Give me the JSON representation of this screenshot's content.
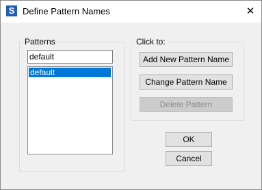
{
  "window": {
    "title": "Define Pattern Names",
    "app_icon_letter": "S",
    "close_symbol": "✕"
  },
  "patterns_group": {
    "label": "Patterns",
    "name_input_value": "default",
    "list_items": [
      "default"
    ],
    "selected_index": 0
  },
  "click_group": {
    "label": "Click to:",
    "add_label": "Add New Pattern Name",
    "change_label": "Change Pattern Name",
    "delete_label": "Delete Pattern"
  },
  "dialog_buttons": {
    "ok_label": "OK",
    "cancel_label": "Cancel"
  },
  "colors": {
    "selection": "#0078d7",
    "dialog_bg": "#f0f0f0",
    "disabled_text": "#8d8d8d"
  }
}
